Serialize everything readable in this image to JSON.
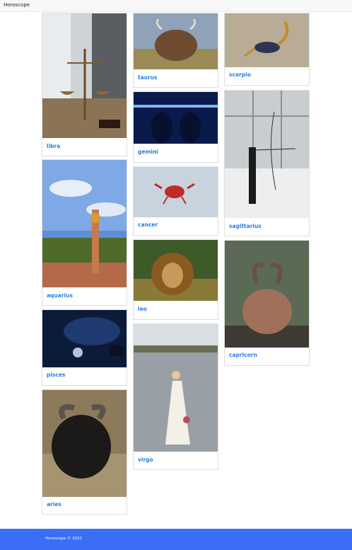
{
  "navbar": {
    "brand": "Horoscope"
  },
  "cards": {
    "libra": {
      "title": "libra",
      "image": "libra-scales-photo"
    },
    "aquarius": {
      "title": "aquarius",
      "image": "aquarius-woman-walking-photo"
    },
    "pisces": {
      "title": "pisces",
      "image": "pisces-aquarium-photo"
    },
    "aries": {
      "title": "aries",
      "image": "aries-ram-photo"
    },
    "taurus": {
      "title": "taurus",
      "image": "taurus-highland-cow-photo"
    },
    "gemini": {
      "title": "gemini",
      "image": "gemini-two-figures-photo"
    },
    "cancer": {
      "title": "cancer",
      "image": "cancer-crab-photo"
    },
    "leo": {
      "title": "leo",
      "image": "leo-lion-photo"
    },
    "virgo": {
      "title": "virgo",
      "image": "virgo-woman-lake-photo"
    },
    "scorpio": {
      "title": "scorpio",
      "image": "scorpio-scorpion-photo"
    },
    "sagittarius": {
      "title": "sagittarius",
      "image": "sagittarius-archer-photo"
    },
    "capricorn": {
      "title": "capricorn",
      "image": "capricorn-ibex-photo"
    }
  },
  "footer": {
    "text": "Horoscope © 2021"
  },
  "colors": {
    "link": "#2b7de0",
    "footer_bg": "#3b6ef7",
    "navbar_bg": "#f7f7f8"
  }
}
